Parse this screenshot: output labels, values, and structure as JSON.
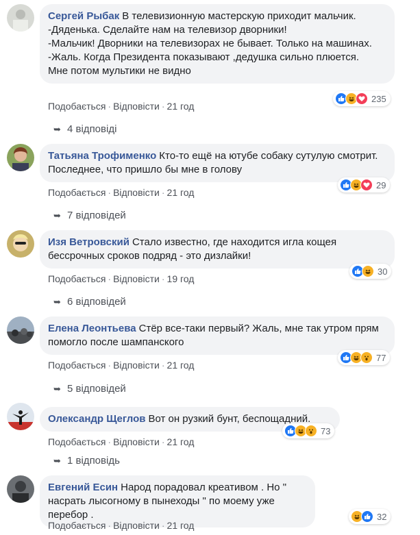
{
  "comments": [
    {
      "author": "Сергей Рыбак",
      "text": "В телевизионную мастерскую приходит мальчик.\n-Дяденька. Сделайте нам на телевизор дворники!\n-Мальчик! Дворники на телевизорах не бывает. Только на машинах.\n-Жаль. Когда Президента показывают ,дедушка сильно плюется.\nМне потом мультики не видно",
      "like_label": "Подобається",
      "reply_label": "Відповісти",
      "time": "21 год",
      "reactions": [
        "like",
        "haha",
        "love"
      ],
      "reaction_count": "235",
      "replies": "4 відповіді"
    },
    {
      "author": "Татьяна Трофименко",
      "text": "Кто-то ещё на ютубе собаку сутулую смотрит. Последнее, что пришло бы мне в голову",
      "like_label": "Подобається",
      "reply_label": "Відповісти",
      "time": "21 год",
      "reactions": [
        "like",
        "haha",
        "love"
      ],
      "reaction_count": "29",
      "replies": "7 відповідей"
    },
    {
      "author": "Изя Ветровский",
      "text": "Стало известно, где находится игла кощея бессрочных сроков подряд - это дизлайки!",
      "like_label": "Подобається",
      "reply_label": "Відповісти",
      "time": "19 год",
      "reactions": [
        "like",
        "haha"
      ],
      "reaction_count": "30",
      "replies": "6 відповідей"
    },
    {
      "author": "Елена Леонтьева",
      "text": "Стёр все-таки первый? Жаль, мне так утром прям помогло после шампанского",
      "like_label": "Подобається",
      "reply_label": "Відповісти",
      "time": "21 год",
      "reactions": [
        "like",
        "haha",
        "wow"
      ],
      "reaction_count": "77",
      "replies": "5 відповідей"
    },
    {
      "author": "Олександр Щеглов",
      "text": "Вот он рузкий бунт, беспощадний.",
      "like_label": "Подобається",
      "reply_label": "Відповісти",
      "time": "21 год",
      "reactions": [
        "like",
        "haha",
        "wow"
      ],
      "reaction_count": "73",
      "replies": "1 відповідь"
    },
    {
      "author": "Евгений Есин",
      "text": "Народ порадовал креативом . Но \" насрать лысогному в пынеходы \" по моему уже перебор .",
      "like_label": "Подобається",
      "reply_label": "Відповісти",
      "time": "21 год",
      "reactions": [
        "haha",
        "like"
      ],
      "reaction_count": "32",
      "replies": ""
    }
  ],
  "colors": {
    "author": "#385898",
    "bubble": "#f2f3f5",
    "meta": "#606770",
    "like": "#2078f4",
    "haha": "#f7b125",
    "love": "#f33e58"
  }
}
